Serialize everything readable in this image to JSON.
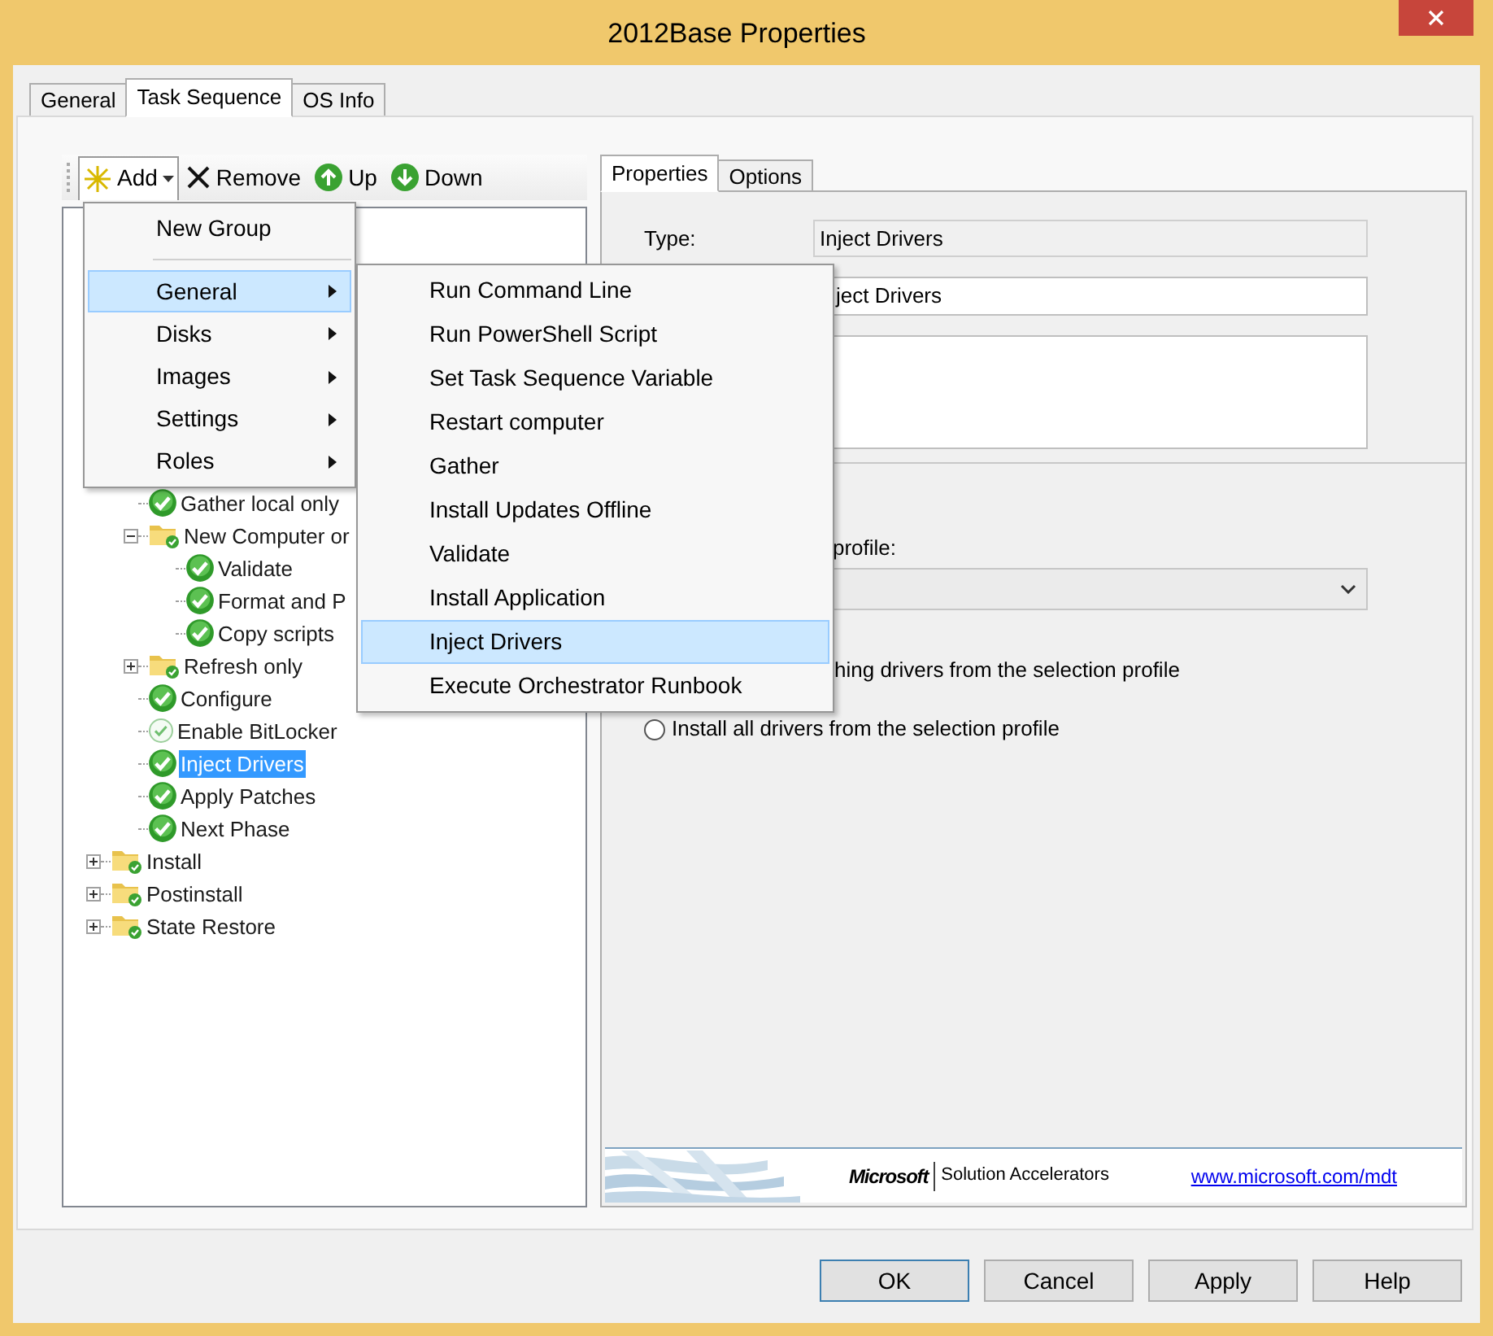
{
  "window": {
    "title": "2012Base Properties"
  },
  "tabs": [
    {
      "label": "General",
      "selected": false
    },
    {
      "label": "Task Sequence",
      "selected": true
    },
    {
      "label": "OS Info",
      "selected": false
    }
  ],
  "toolbar": {
    "add": "Add",
    "add_open": true,
    "remove": "Remove",
    "up": "Up",
    "down": "Down"
  },
  "tree": {
    "items": [
      {
        "kind": "hidden_group",
        "children": [
          {
            "kind": "step",
            "label": "Gather local only",
            "disabled": false,
            "selected": false
          },
          {
            "kind": "group",
            "label": "New Computer or",
            "expanded": true,
            "selected": false,
            "children": [
              {
                "kind": "step",
                "label": "Validate",
                "disabled": false,
                "selected": false
              },
              {
                "kind": "step",
                "label": "Format and P",
                "disabled": false,
                "selected": false
              },
              {
                "kind": "step",
                "label": "Copy scripts",
                "disabled": false,
                "selected": false
              }
            ]
          },
          {
            "kind": "group",
            "label": "Refresh only",
            "expanded": false,
            "selected": false
          },
          {
            "kind": "step",
            "label": "Configure",
            "disabled": false,
            "selected": false
          },
          {
            "kind": "step",
            "label": "Enable BitLocker",
            "disabled": true,
            "selected": false
          },
          {
            "kind": "step",
            "label": "Inject Drivers",
            "disabled": false,
            "selected": true
          },
          {
            "kind": "step",
            "label": "Apply Patches",
            "disabled": false,
            "selected": false
          },
          {
            "kind": "step",
            "label": "Next Phase",
            "disabled": false,
            "selected": false
          }
        ]
      },
      {
        "kind": "group",
        "label": "Install",
        "expanded": false,
        "selected": false
      },
      {
        "kind": "group",
        "label": "Postinstall",
        "expanded": false,
        "selected": false
      },
      {
        "kind": "group",
        "label": "State Restore",
        "expanded": false,
        "selected": false
      }
    ]
  },
  "add_menu": {
    "items": [
      {
        "kind": "item",
        "label": "New Group",
        "selected": false
      },
      {
        "kind": "separator"
      },
      {
        "kind": "submenu",
        "label": "General",
        "selected": true
      },
      {
        "kind": "submenu",
        "label": "Disks",
        "selected": false
      },
      {
        "kind": "submenu",
        "label": "Images",
        "selected": false
      },
      {
        "kind": "submenu",
        "label": "Settings",
        "selected": false
      },
      {
        "kind": "submenu",
        "label": "Roles",
        "selected": false
      }
    ]
  },
  "general_submenu": {
    "items": [
      {
        "label": "Run Command Line",
        "selected": false
      },
      {
        "label": "Run PowerShell Script",
        "selected": false
      },
      {
        "label": "Set Task Sequence Variable",
        "selected": false
      },
      {
        "label": "Restart computer",
        "selected": false
      },
      {
        "label": "Gather",
        "selected": false
      },
      {
        "label": "Install Updates Offline",
        "selected": false
      },
      {
        "label": "Validate",
        "selected": false
      },
      {
        "label": "Install Application",
        "selected": false
      },
      {
        "label": "Inject Drivers",
        "selected": true
      },
      {
        "label": "Execute Orchestrator Runbook",
        "selected": false
      }
    ]
  },
  "detail_tabs": [
    {
      "label": "Properties",
      "selected": true
    },
    {
      "label": "Options",
      "selected": false
    }
  ],
  "properties": {
    "type_label": "Type:",
    "type_value": "Inject Drivers",
    "name_value": "ject Drivers",
    "profile_label": "profile:",
    "radios": [
      {
        "label": "hing drivers from the selection profile"
      },
      {
        "label": "Install all drivers from the selection profile",
        "selected": false
      }
    ]
  },
  "banner": {
    "brand": "Microsoft",
    "product": "Solution Accelerators",
    "link": "www.microsoft.com/mdt"
  },
  "buttons": [
    {
      "label": "OK",
      "default": true
    },
    {
      "label": "Cancel",
      "default": false
    },
    {
      "label": "Apply",
      "default": false
    },
    {
      "label": "Help",
      "default": false
    }
  ]
}
